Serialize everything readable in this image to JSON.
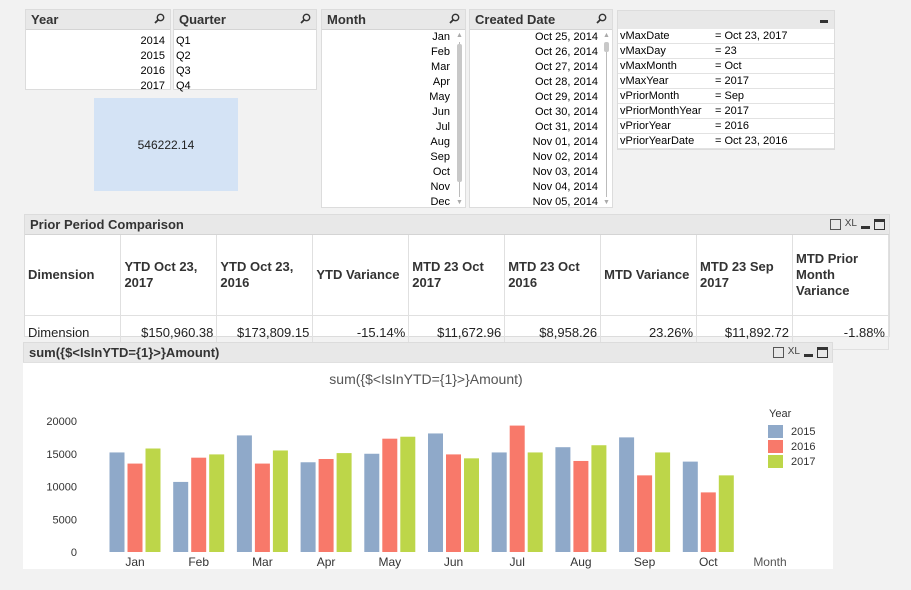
{
  "listboxes": {
    "year": {
      "title": "Year",
      "items": [
        "2014",
        "2015",
        "2016",
        "2017"
      ]
    },
    "quarter": {
      "title": "Quarter",
      "items": [
        "Q1",
        "Q2",
        "Q3",
        "Q4"
      ]
    },
    "month": {
      "title": "Month",
      "items": [
        "Jan",
        "Feb",
        "Mar",
        "Apr",
        "May",
        "Jun",
        "Jul",
        "Aug",
        "Sep",
        "Oct",
        "Nov",
        "Dec"
      ]
    },
    "created_date": {
      "title": "Created Date",
      "items": [
        "Oct 25, 2014",
        "Oct 26, 2014",
        "Oct 27, 2014",
        "Oct 28, 2014",
        "Oct 29, 2014",
        "Oct 30, 2014",
        "Oct 31, 2014",
        "Nov 01, 2014",
        "Nov 02, 2014",
        "Nov 03, 2014",
        "Nov 04, 2014",
        "Nov 05, 2014"
      ]
    }
  },
  "kpi": {
    "value": "546222.14"
  },
  "variables": [
    {
      "name": "vMaxDate",
      "value": "= Oct 23, 2017"
    },
    {
      "name": "vMaxDay",
      "value": "= 23"
    },
    {
      "name": "vMaxMonth",
      "value": "= Oct"
    },
    {
      "name": "vMaxYear",
      "value": "= 2017"
    },
    {
      "name": "vPriorMonth",
      "value": "= Sep"
    },
    {
      "name": "vPriorMonthYear",
      "value": "= 2017"
    },
    {
      "name": "vPriorYear",
      "value": "= 2016"
    },
    {
      "name": "vPriorYearDate",
      "value": "= Oct 23, 2016"
    }
  ],
  "comparison": {
    "title": "Prior Period Comparison",
    "xl_label": "XL",
    "headers": [
      "Dimension",
      "YTD Oct 23, 2017",
      "YTD Oct 23, 2016",
      "YTD Variance",
      "MTD 23 Oct 2017",
      "MTD 23 Oct 2016",
      "MTD Variance",
      "MTD 23 Sep 2017",
      "MTD Prior Month Variance"
    ],
    "row": [
      "Dimension",
      "$150,960.38",
      "$173,809.15",
      "-15.14%",
      "$11,672.96",
      "$8,958.26",
      "23.26%",
      "$11,892.72",
      "-1.88%"
    ],
    "colors": {
      "negative": "#e8332e",
      "positive": "#2a8a2a"
    }
  },
  "chart_panel": {
    "title": "sum({$<IsInYTD={1}>}Amount)",
    "xl_label": "XL"
  },
  "chart_data": {
    "type": "bar",
    "title": "sum({$<IsInYTD={1}>}Amount)",
    "xlabel": "Month",
    "ylabel": "",
    "ylim": [
      0,
      20000
    ],
    "yticks": [
      "0",
      "5000",
      "10000",
      "15000",
      "20000"
    ],
    "legend_title": "Year",
    "legend_position": "right",
    "categories": [
      "Jan",
      "Feb",
      "Mar",
      "Apr",
      "May",
      "Jun",
      "Jul",
      "Aug",
      "Sep",
      "Oct"
    ],
    "series": [
      {
        "name": "2015",
        "color": "#8fa9c9",
        "values": [
          15200,
          10700,
          17800,
          13700,
          15000,
          18100,
          15200,
          16000,
          17500,
          13800
        ]
      },
      {
        "name": "2016",
        "color": "#f8796a",
        "values": [
          13500,
          14400,
          13500,
          14200,
          17300,
          14900,
          19300,
          13900,
          11700,
          9100
        ]
      },
      {
        "name": "2017",
        "color": "#bdd649",
        "values": [
          15800,
          14900,
          15500,
          15100,
          17600,
          14300,
          15200,
          16300,
          15200,
          11700
        ]
      }
    ]
  }
}
